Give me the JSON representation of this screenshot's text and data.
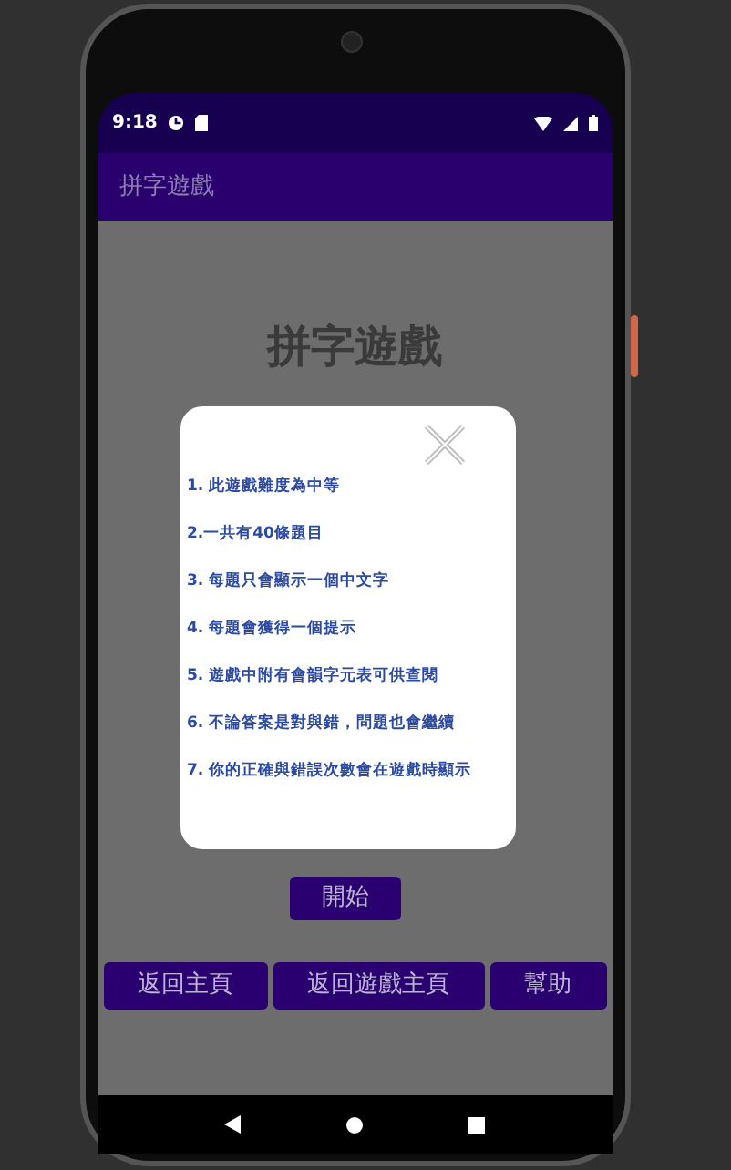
{
  "status_bar": {
    "time": "9:18"
  },
  "app_bar": {
    "title": "拼字遊戲"
  },
  "heading": "拼字遊戲",
  "dialog": {
    "rules": [
      "1. 此遊戲難度為中等",
      "2.一共有40條題目",
      "3. 每題只會顯示一個中文字",
      "4. 每題會獲得一個提示",
      "5. 遊戲中附有會韻字元表可供查閱",
      "6. 不論答案是對與錯，問題也會繼續",
      "7. 你的正確與錯誤次數會在遊戲時顯示"
    ]
  },
  "start_button": "開始",
  "bottom_buttons": [
    "返回主頁",
    "返回遊戲主頁",
    "幫助"
  ]
}
